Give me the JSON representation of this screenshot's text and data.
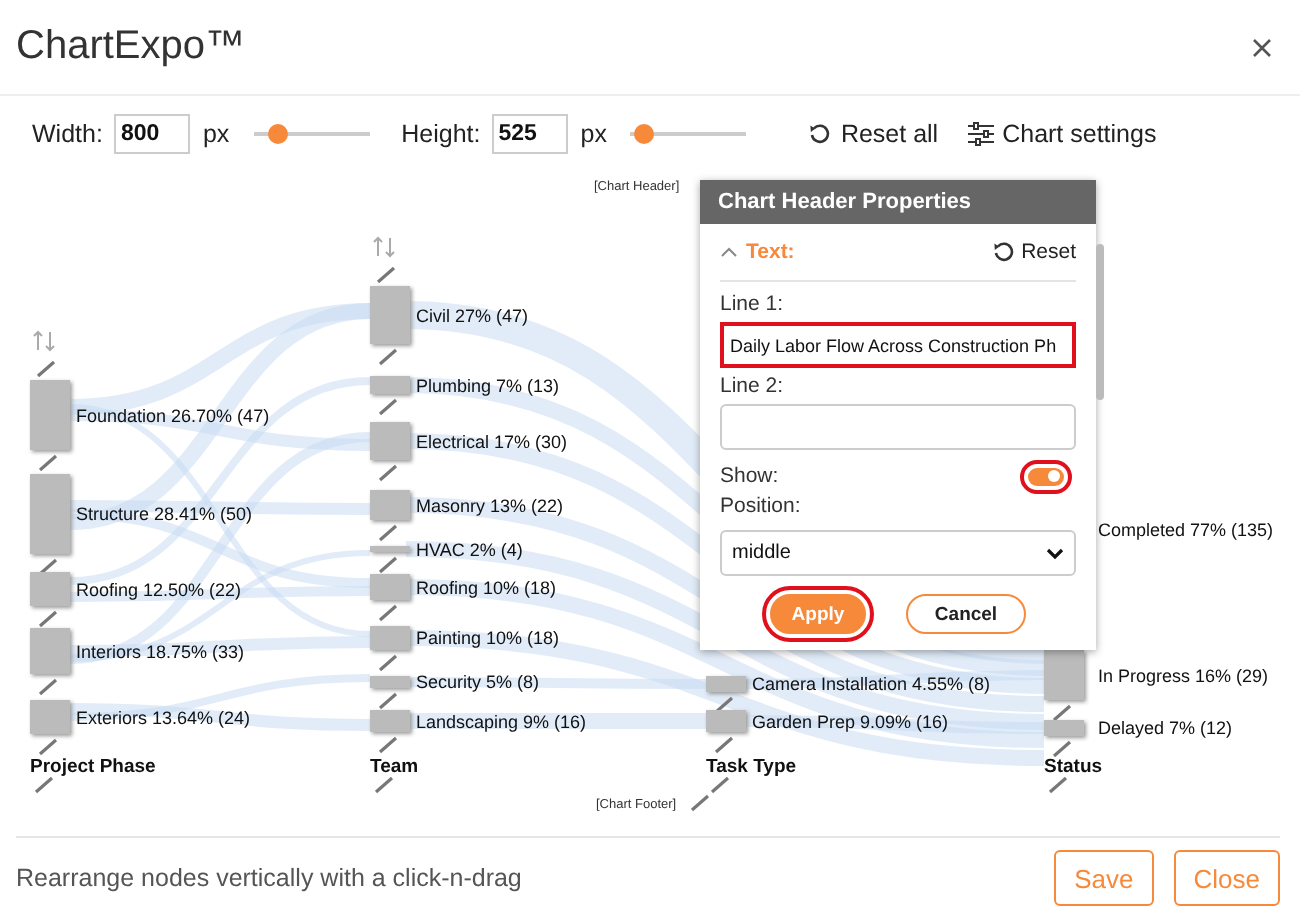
{
  "window": {
    "title": "ChartExpo™"
  },
  "toolbar": {
    "width": {
      "label": "Width:",
      "value": "800",
      "unit": "px",
      "level": 0.22
    },
    "height": {
      "label": "Height:",
      "value": "525",
      "unit": "px",
      "level": 0.12
    },
    "actions": [
      {
        "kind": "reset",
        "label": "Reset all"
      },
      {
        "kind": "settings",
        "label": "Chart settings"
      }
    ]
  },
  "chart": {
    "header": "[Chart Header]",
    "footer": "[Chart Footer]",
    "columns": [
      {
        "title": "Project Phase",
        "sortable": true,
        "nodes": [
          "Foundation 26.70% (47)",
          "Structure 28.41% (50)",
          "Roofing 12.50% (22)",
          "Interiors 18.75% (33)",
          "Exteriors 13.64% (24)"
        ]
      },
      {
        "title": "Team",
        "sortable": true,
        "nodes": [
          "Civil 27% (47)",
          "Plumbing 7% (13)",
          "Electrical 17% (30)",
          "Masonry 13% (22)",
          "HVAC 2% (4)",
          "Roofing 10% (18)",
          "Painting 10% (18)",
          "Security 5% (8)",
          "Landscaping 9% (16)"
        ]
      },
      {
        "title": "Task Type",
        "sortable": false,
        "nodes": [
          "Camera Installation 4.55% (8)",
          "Garden Prep 9.09% (16)"
        ]
      },
      {
        "title": "Status",
        "sortable": false,
        "nodes": [
          "Completed 77% (135)",
          "In Progress 16% (29)",
          "Delayed 7% (12)"
        ]
      }
    ]
  },
  "popup": {
    "title": "Chart Header Properties",
    "section": {
      "label": "Text:",
      "expanded": true,
      "reset": "Reset"
    },
    "line1": {
      "label": "Line 1:",
      "value": "Daily Labor Flow Across Construction Ph",
      "highlighted": true
    },
    "line2": {
      "label": "Line 2:"
    },
    "show": {
      "label": "Show:",
      "on": true,
      "highlighted": true
    },
    "position": {
      "label": "Position:",
      "value": "middle"
    },
    "buttons": [
      {
        "kind": "primary",
        "label": "Apply",
        "highlighted": true
      },
      {
        "kind": "secondary",
        "label": "Cancel",
        "highlighted": false
      }
    ]
  },
  "footer": {
    "hint": "Rearrange nodes vertically with a click-n-drag",
    "buttons": [
      "Save",
      "Close"
    ]
  }
}
